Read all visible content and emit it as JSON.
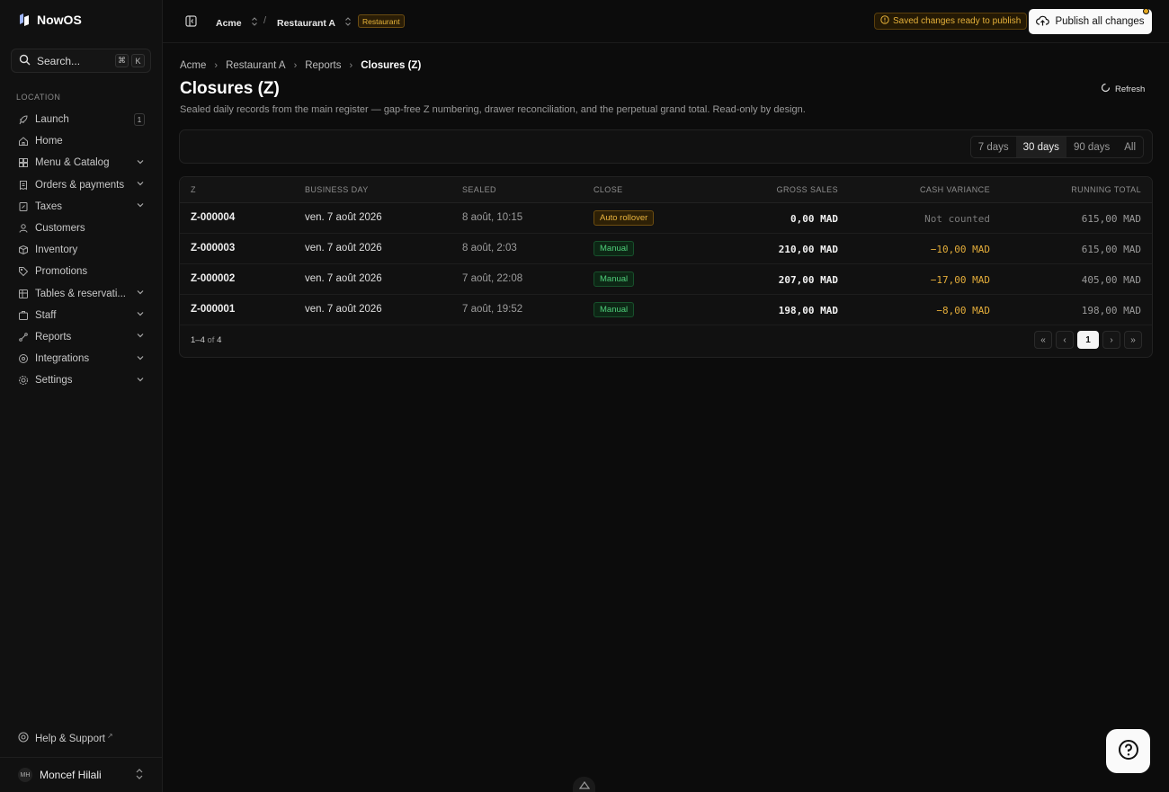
{
  "app": {
    "name": "NowOS"
  },
  "search": {
    "label": "Search...",
    "keys": [
      "⌘",
      "K"
    ]
  },
  "sidebar": {
    "section_label": "LOCATION",
    "items": [
      {
        "label": "Launch",
        "icon": "rocket-icon",
        "badge": "1"
      },
      {
        "label": "Home",
        "icon": "home-icon"
      },
      {
        "label": "Menu & Catalog",
        "icon": "grid-icon",
        "expandable": true
      },
      {
        "label": "Orders & payments",
        "icon": "receipt-icon",
        "expandable": true
      },
      {
        "label": "Taxes",
        "icon": "tax-icon",
        "expandable": true
      },
      {
        "label": "Customers",
        "icon": "users-icon"
      },
      {
        "label": "Inventory",
        "icon": "box-icon"
      },
      {
        "label": "Promotions",
        "icon": "tag-icon"
      },
      {
        "label": "Tables & reservati...",
        "icon": "table-icon",
        "expandable": true
      },
      {
        "label": "Staff",
        "icon": "staff-icon",
        "expandable": true
      },
      {
        "label": "Reports",
        "icon": "reports-icon",
        "expandable": true
      },
      {
        "label": "Integrations",
        "icon": "plug-icon",
        "expandable": true
      },
      {
        "label": "Settings",
        "icon": "gear-icon",
        "expandable": true
      }
    ],
    "help_label": "Help & Support",
    "user": {
      "initials": "MH",
      "name": "Moncef Hilali"
    }
  },
  "topbar": {
    "org": "Acme",
    "separator": "/",
    "location": "Restaurant A",
    "location_tag": "Restaurant",
    "saved_notice": "Saved changes ready to publish",
    "publish_label": "Publish all changes"
  },
  "breadcrumb": [
    "Acme",
    "Restaurant A",
    "Reports",
    "Closures (Z)"
  ],
  "page": {
    "title": "Closures (Z)",
    "description": "Sealed daily records from the main register — gap-free Z numbering, drawer reconciliation, and the perpetual grand total. Read-only by design.",
    "refresh_label": "Refresh"
  },
  "ranges": {
    "options": [
      "7 days",
      "30 days",
      "90 days",
      "All"
    ],
    "selected": "30 days"
  },
  "table": {
    "columns": [
      "Z",
      "BUSINESS DAY",
      "SEALED",
      "CLOSE",
      "GROSS SALES",
      "CASH VARIANCE",
      "RUNNING TOTAL"
    ],
    "rows": [
      {
        "z": "Z-000004",
        "day": "ven. 7 août 2026",
        "sealed": "8 août, 10:15",
        "close": "Auto rollover",
        "close_kind": "auto",
        "gross": "0,00 MAD",
        "variance": "Not counted",
        "variance_kind": "na",
        "running": "615,00 MAD"
      },
      {
        "z": "Z-000003",
        "day": "ven. 7 août 2026",
        "sealed": "8 août, 2:03",
        "close": "Manual",
        "close_kind": "manual",
        "gross": "210,00 MAD",
        "variance": "−10,00 MAD",
        "variance_kind": "neg",
        "running": "615,00 MAD"
      },
      {
        "z": "Z-000002",
        "day": "ven. 7 août 2026",
        "sealed": "7 août, 22:08",
        "close": "Manual",
        "close_kind": "manual",
        "gross": "207,00 MAD",
        "variance": "−17,00 MAD",
        "variance_kind": "neg",
        "running": "405,00 MAD"
      },
      {
        "z": "Z-000001",
        "day": "ven. 7 août 2026",
        "sealed": "7 août, 19:52",
        "close": "Manual",
        "close_kind": "manual",
        "gross": "198,00 MAD",
        "variance": "−8,00 MAD",
        "variance_kind": "neg",
        "running": "198,00 MAD"
      }
    ],
    "footer": {
      "range": "1–4",
      "of": "of",
      "total": "4"
    },
    "pagination": {
      "current_page": "1"
    }
  },
  "colors": {
    "accent_amber": "#e6b13a",
    "accent_green": "#4fcf7a",
    "background": "#0c0c0c"
  }
}
